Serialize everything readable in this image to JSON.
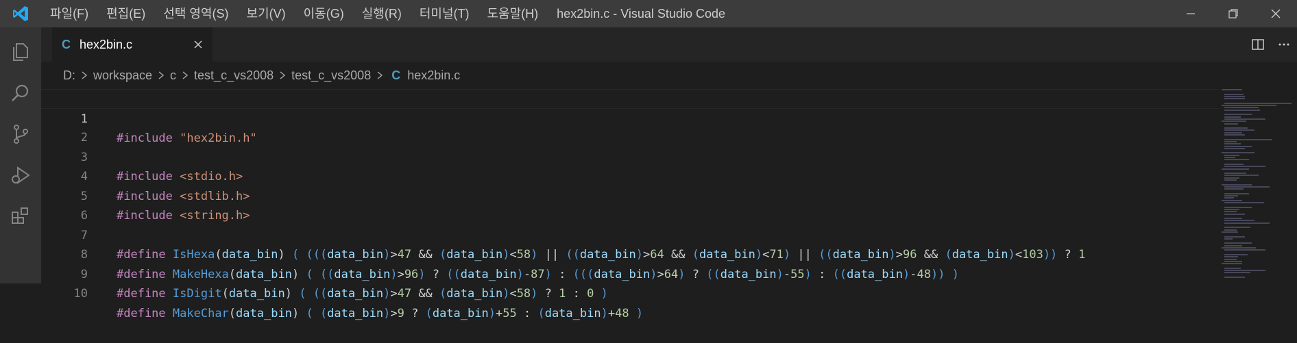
{
  "titlebar": {
    "menu": [
      "파일(F)",
      "편집(E)",
      "선택 영역(S)",
      "보기(V)",
      "이동(G)",
      "실행(R)",
      "터미널(T)",
      "도움말(H)"
    ],
    "window_title": "hex2bin.c - Visual Studio Code"
  },
  "activitybar": {
    "icons": [
      "explorer-icon",
      "search-icon",
      "source-control-icon",
      "run-debug-icon",
      "extensions-icon"
    ]
  },
  "tab": {
    "icon_letter": "C",
    "label": "hex2bin.c"
  },
  "breadcrumb": {
    "items": [
      "D:",
      "workspace",
      "c",
      "test_c_vs2008",
      "test_c_vs2008"
    ],
    "file_icon_letter": "C",
    "file": "hex2bin.c"
  },
  "editor": {
    "line_numbers": [
      "1",
      "2",
      "3",
      "4",
      "5",
      "6",
      "7",
      "8",
      "9",
      "10"
    ],
    "lines": [
      "#include \"hex2bin.h\"",
      "",
      "#include <stdio.h>",
      "#include <stdlib.h>",
      "#include <string.h>",
      "",
      "#define IsHexa(data_bin) ( (((data_bin)>47 && (data_bin)<58) || ((data_bin)>64 && (data_bin)<71) || ((data_bin)>96 && (data_bin)<103)) ? 1",
      "#define MakeHexa(data_bin) ( ((data_bin)>96) ? ((data_bin)-87) : (((data_bin)>64) ? ((data_bin)-55) : ((data_bin)-48)) )",
      "#define IsDigit(data_bin) ( ((data_bin)>47 && (data_bin)<58) ? 1 : 0 )",
      "#define MakeChar(data_bin) ( (data_bin)>9 ? (data_bin)+55 : (data_bin)+48 )"
    ]
  },
  "colors": {
    "titlebar_bg": "#3c3c3c",
    "activitybar_bg": "#333333",
    "editor_bg": "#1e1e1e",
    "c_icon": "#519aba",
    "keyword": "#c586c0",
    "string": "#ce9178",
    "macro_name": "#569cd6",
    "param": "#9cdcfe",
    "number": "#b5cea8"
  }
}
